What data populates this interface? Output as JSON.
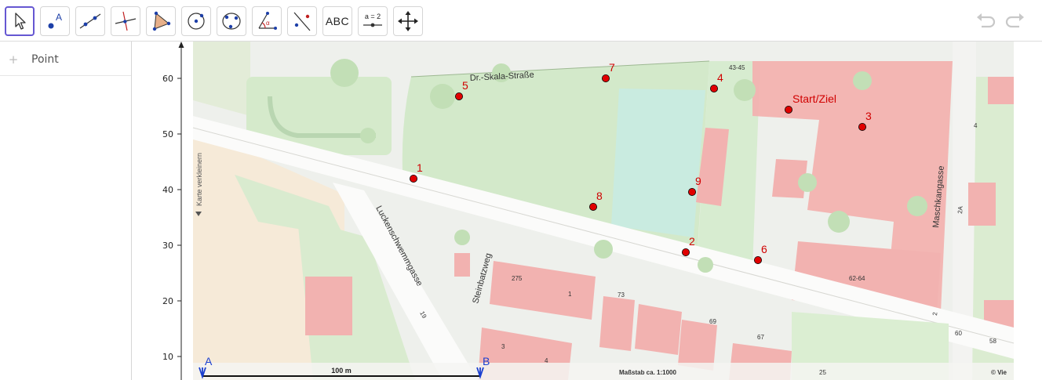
{
  "toolbar": {
    "tools": [
      {
        "name": "move-tool",
        "icon": "cursor-arrow-icon"
      },
      {
        "name": "point-tool",
        "icon": "point-a-icon",
        "label": "A"
      },
      {
        "name": "line-tool",
        "icon": "line-through-points-icon"
      },
      {
        "name": "perpendicular-line-tool",
        "icon": "perpendicular-line-icon"
      },
      {
        "name": "polygon-tool",
        "icon": "polygon-icon"
      },
      {
        "name": "circle-center-tool",
        "icon": "circle-center-icon"
      },
      {
        "name": "circle-three-points-tool",
        "icon": "ellipse-icon"
      },
      {
        "name": "angle-tool",
        "icon": "angle-icon",
        "label": "α"
      },
      {
        "name": "reflect-tool",
        "icon": "reflect-line-icon"
      },
      {
        "name": "text-tool",
        "icon": "text-abc-icon",
        "label": "ABC"
      },
      {
        "name": "slider-tool",
        "icon": "slider-icon",
        "label": "a = 2"
      },
      {
        "name": "move-graphics-tool",
        "icon": "move-arrows-icon"
      }
    ],
    "undo": "undo-icon",
    "redo": "redo-icon"
  },
  "algebra": {
    "item_label": "Point",
    "expand_icon": "+"
  },
  "graphics": {
    "y_ticks": [
      "10",
      "20",
      "30",
      "40",
      "50",
      "60"
    ],
    "y_tick_values": [
      10,
      20,
      30,
      40,
      50,
      60
    ],
    "side_label": "Karte verkleinern",
    "points": [
      {
        "label": "1"
      },
      {
        "label": "2"
      },
      {
        "label": "3"
      },
      {
        "label": "4"
      },
      {
        "label": "5"
      },
      {
        "label": "6"
      },
      {
        "label": "7"
      },
      {
        "label": "8"
      },
      {
        "label": "9"
      },
      {
        "label": "Start/Ziel"
      }
    ],
    "segment": {
      "start_label": "A",
      "end_label": "B",
      "length_label": "100 m"
    },
    "map": {
      "streets": {
        "dr_skala": "Dr.-Skala-Straße",
        "lucken": "Luckenschwemmgasse",
        "steinbatz": "Steinbatzweg",
        "masch": "Maschkangasse"
      },
      "house_numbers": [
        "43-45",
        "62-64",
        "2A",
        "4",
        "2",
        "60",
        "58",
        "73",
        "67",
        "69",
        "19",
        "275",
        "1",
        "3",
        "4",
        "25"
      ],
      "scale_text": "Maßstab ca. 1:1000",
      "copyright": "© Vie"
    },
    "colors": {
      "point": "#e00000",
      "point_label": "#d00000",
      "segment": "#1a3fd0",
      "park": "#d7eccd",
      "building": "#f2b2b0",
      "field": "#f6ead8",
      "court": "#c9ebe0"
    }
  }
}
